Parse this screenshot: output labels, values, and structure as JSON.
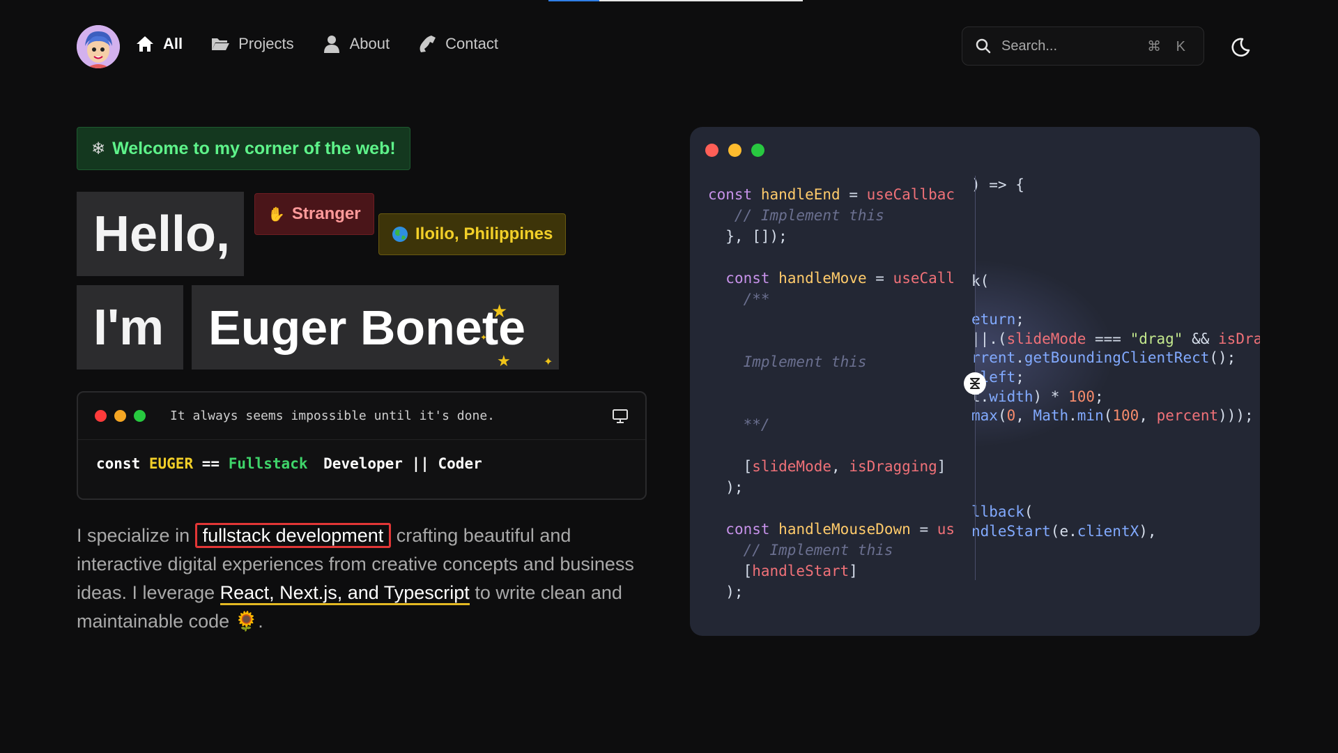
{
  "nav": {
    "links": [
      {
        "label": "All"
      },
      {
        "label": "Projects"
      },
      {
        "label": "About"
      },
      {
        "label": "Contact"
      }
    ],
    "search_placeholder": "Search...",
    "search_shortcut": "⌘ K"
  },
  "hero": {
    "welcome": "Welcome to my corner of the web!",
    "hello": "Hello,",
    "im": "I'm",
    "name": "Euger Bonete",
    "tag_stranger": "Stranger",
    "tag_location": "Iloilo, Philippines"
  },
  "terminal": {
    "quote": "It always seems impossible until it's done.",
    "code": {
      "kw": "const",
      "var": "EUGER",
      "op": "==",
      "role": "Fullstack",
      "rest": "Developer || Coder"
    }
  },
  "bio": {
    "part1": "I specialize in",
    "highlight1": "fullstack development",
    "part2": "crafting beautiful and interactive digital experiences from creative concepts and business ideas. I leverage",
    "highlight2": "React, Next.js, and Typescript",
    "part3": "to write clean and maintainable code",
    "emoji": "🌻",
    "end": "."
  },
  "code_panel": {
    "left_lines": [
      "const handleEnd = useCallbac",
      "   // Implement this",
      "  }, []);",
      "",
      "  const handleMove = useCall",
      "    /**",
      "",
      "",
      "    Implement this",
      "",
      "",
      "    **/",
      "",
      "    [slideMode, isDragging]",
      "  );",
      "",
      "  const handleMouseDown = us",
      "    // Implement this",
      "    [handleStart]",
      "  );"
    ],
    "right_lines": [
      ") => {",
      "",
      "",
      "",
      "",
      "k(",
      "",
      "eturn;",
      "||.(slideMode === \"drag\" && isDra",
      "rrent.getBoundingClientRect();",
      ".left;",
      "t.width) * 100;",
      "max(0, Math.min(100, percent)));",
      "",
      "",
      "",
      "",
      "llback(",
      "ndleStart(e.clientX),"
    ]
  },
  "colors": {
    "accent_blue": "#2f7ee6",
    "welcome_green": "#5ef38a",
    "tag_red": "#ff9a9a",
    "tag_yellow": "#f2cf28",
    "highlight_red": "#e23636",
    "underline_yellow": "#e3b923"
  },
  "progress": {
    "fraction": 0.2
  }
}
